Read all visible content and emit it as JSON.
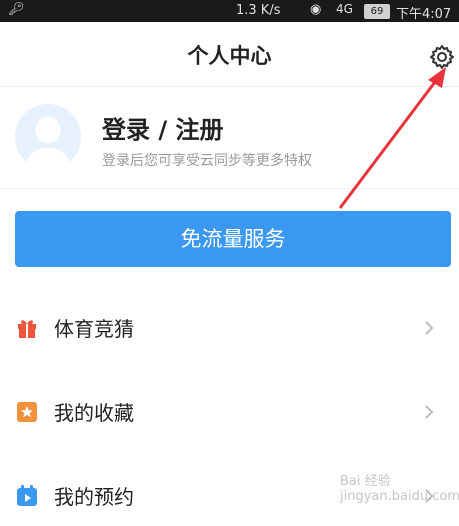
{
  "status_bar": {
    "speed": "1.3 K/s",
    "signal": "4G",
    "battery": "69",
    "time": "下午4:07"
  },
  "header": {
    "title": "个人中心"
  },
  "profile": {
    "title": "登录 / 注册",
    "subtitle": "登录后您可享受云同步等更多特权"
  },
  "free_button": {
    "label": "免流量服务"
  },
  "menu": {
    "items": [
      {
        "label": "体育竞猜",
        "icon": "gift-icon"
      },
      {
        "label": "我的收藏",
        "icon": "star-bookmark-icon"
      },
      {
        "label": "我的预约",
        "icon": "calendar-icon"
      }
    ]
  },
  "colors": {
    "accent": "#3a98f0",
    "arrow": "#e8333c",
    "gift": "#f0553c",
    "star": "#f0913c",
    "calendar": "#3a98f0"
  },
  "watermark": "Bai 经验 jingyan.baidu.com"
}
